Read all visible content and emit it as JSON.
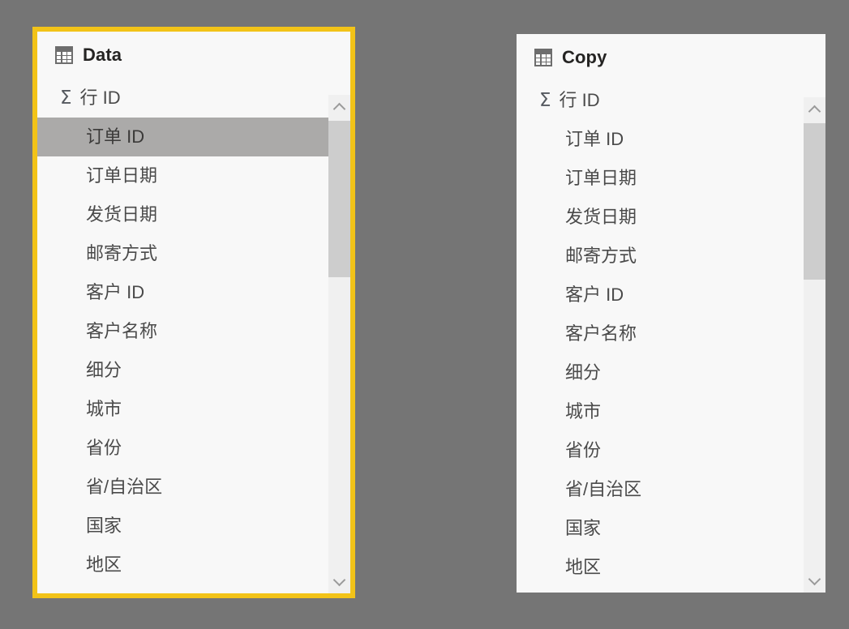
{
  "panels": [
    {
      "title": "Data",
      "icon": "table-icon",
      "selected": true,
      "fields": [
        {
          "label": "行 ID",
          "type": "measure",
          "icon": "sigma-icon",
          "selected": false
        },
        {
          "label": "订单 ID",
          "type": "column",
          "selected": true
        },
        {
          "label": "订单日期",
          "type": "column",
          "selected": false
        },
        {
          "label": "发货日期",
          "type": "column",
          "selected": false
        },
        {
          "label": "邮寄方式",
          "type": "column",
          "selected": false
        },
        {
          "label": "客户 ID",
          "type": "column",
          "selected": false
        },
        {
          "label": "客户名称",
          "type": "column",
          "selected": false
        },
        {
          "label": "细分",
          "type": "column",
          "selected": false
        },
        {
          "label": "城市",
          "type": "column",
          "selected": false
        },
        {
          "label": "省份",
          "type": "column",
          "selected": false
        },
        {
          "label": "省/自治区",
          "type": "column",
          "selected": false
        },
        {
          "label": "国家",
          "type": "column",
          "selected": false
        },
        {
          "label": "地区",
          "type": "column",
          "selected": false
        }
      ]
    },
    {
      "title": "Copy",
      "icon": "table-icon",
      "selected": false,
      "fields": [
        {
          "label": "行 ID",
          "type": "measure",
          "icon": "sigma-icon",
          "selected": false
        },
        {
          "label": "订单 ID",
          "type": "column",
          "selected": false
        },
        {
          "label": "订单日期",
          "type": "column",
          "selected": false
        },
        {
          "label": "发货日期",
          "type": "column",
          "selected": false
        },
        {
          "label": "邮寄方式",
          "type": "column",
          "selected": false
        },
        {
          "label": "客户 ID",
          "type": "column",
          "selected": false
        },
        {
          "label": "客户名称",
          "type": "column",
          "selected": false
        },
        {
          "label": "细分",
          "type": "column",
          "selected": false
        },
        {
          "label": "城市",
          "type": "column",
          "selected": false
        },
        {
          "label": "省份",
          "type": "column",
          "selected": false
        },
        {
          "label": "省/自治区",
          "type": "column",
          "selected": false
        },
        {
          "label": "国家",
          "type": "column",
          "selected": false
        },
        {
          "label": "地区",
          "type": "column",
          "selected": false
        }
      ]
    }
  ],
  "icons": {
    "sigma": "Σ"
  },
  "colors": {
    "background": "#757575",
    "panel_background": "#f8f8f8",
    "selection_border": "#f2c318",
    "selected_row": "#abaaa9",
    "title_text": "#252423",
    "field_text": "#4a4a4a",
    "scrollbar_track": "#f0f0f0",
    "scrollbar_thumb": "#cdcdcd"
  }
}
